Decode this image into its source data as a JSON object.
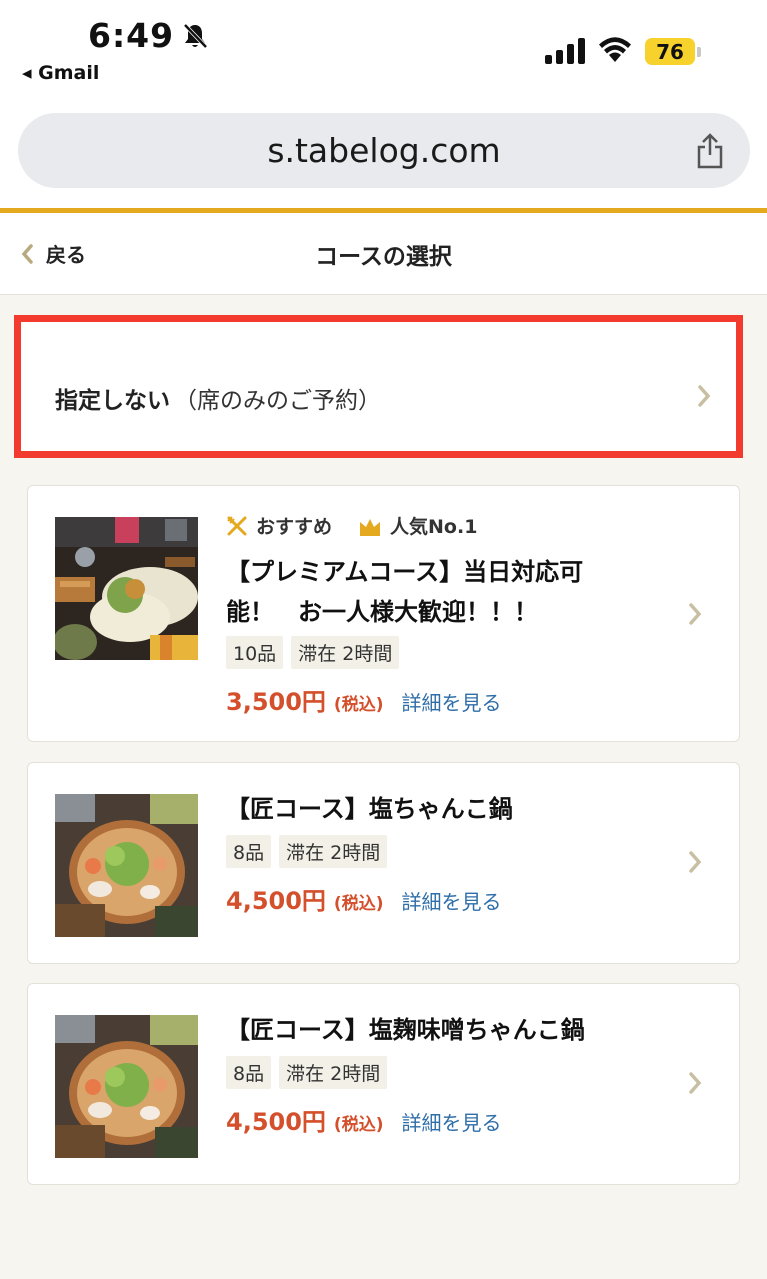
{
  "status_bar": {
    "time": "6:49",
    "back_app": "◂ Gmail",
    "battery": "76"
  },
  "browser": {
    "url": "s.tabelog.com"
  },
  "nav": {
    "back_label": "戻る",
    "title": "コースの選択"
  },
  "no_course": {
    "label": "指定しない",
    "sublabel": "（席のみのご予約）"
  },
  "courses": [
    {
      "badges": [
        "おすすめ",
        "人気No.1"
      ],
      "title_line1": "【プレミアムコース】当日対応可",
      "title_line2": "能！　お一人様大歓迎！！！",
      "items": "10品",
      "stay": "滞在 2時間",
      "price": "3,500円",
      "tax": "(税込)",
      "detail_link": "詳細を見る"
    },
    {
      "title_line1": "【匠コース】塩ちゃんこ鍋",
      "items": "8品",
      "stay": "滞在 2時間",
      "price": "4,500円",
      "tax": "(税込)",
      "detail_link": "詳細を見る"
    },
    {
      "title_line1": "【匠コース】塩麹味噌ちゃんこ鍋",
      "items": "8品",
      "stay": "滞在 2時間",
      "price": "4,500円",
      "tax": "(税込)",
      "detail_link": "詳細を見る"
    }
  ],
  "colors": {
    "accent": "#e4a91e",
    "highlight": "#f23a2e",
    "price": "#d4502c",
    "link": "#2f6ea8"
  }
}
